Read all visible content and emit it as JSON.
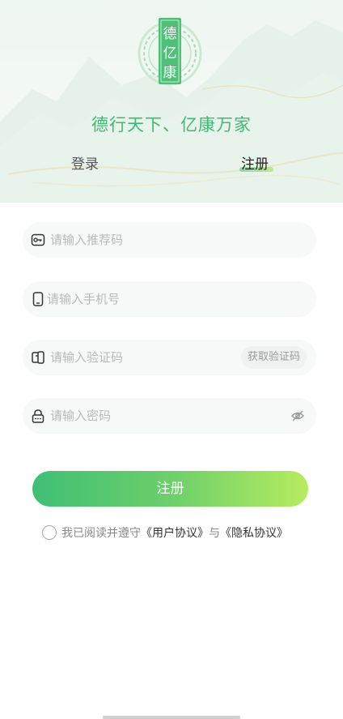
{
  "logo": {
    "chars": [
      "德",
      "亿",
      "康"
    ]
  },
  "slogan": "德行天下、亿康万家",
  "tabs": {
    "login": "登录",
    "register": "注册",
    "active": "register"
  },
  "form": {
    "referral_placeholder": "请输入推荐码",
    "phone_placeholder": "请输入手机号",
    "code_placeholder": "请输入验证码",
    "get_code_label": "获取验证码",
    "password_placeholder": "请输入密码"
  },
  "submit_label": "注册",
  "agreement": {
    "prefix": "我已阅读并遵守",
    "user_agreement": "《用户协议》",
    "joiner": "与",
    "privacy_policy": "《隐私协议》",
    "checked": false
  },
  "icons": {
    "referral": "key-icon",
    "phone": "phone-icon",
    "code": "message-code-icon",
    "password": "lock-icon",
    "visibility": "eye-off-icon"
  },
  "colors": {
    "brand_green": "#3dbb72",
    "gradient_start": "#3fbf75",
    "gradient_end": "#b7ec5f",
    "placeholder": "#b9b9b9"
  }
}
